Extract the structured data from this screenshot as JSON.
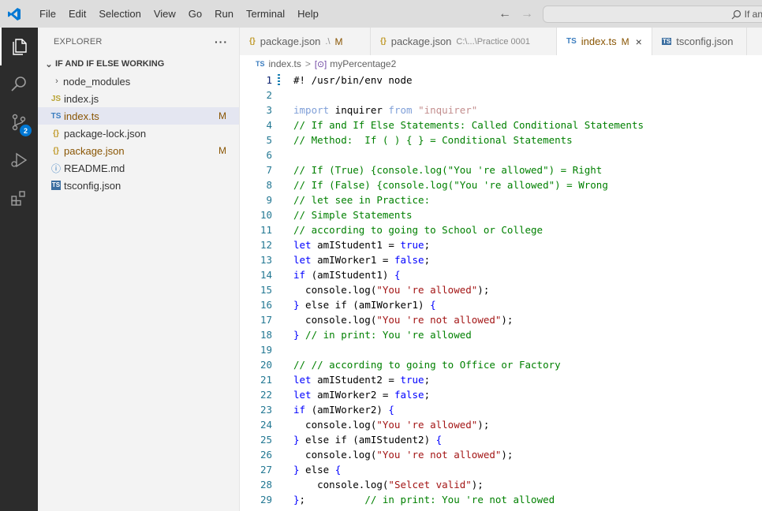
{
  "titlebar": {
    "menu": [
      "File",
      "Edit",
      "Selection",
      "View",
      "Go",
      "Run",
      "Terminal",
      "Help"
    ],
    "search_text": "If an",
    "accent_color": "#007acc"
  },
  "activitybar": {
    "items": [
      "explorer-icon",
      "search-icon",
      "source-control-icon",
      "run-debug-icon",
      "extensions-icon"
    ],
    "source_control_badge": "2"
  },
  "sidebar": {
    "title": "EXPLORER",
    "more": "···",
    "folder": "IF AND IF ELSE WORKING",
    "items": [
      {
        "name": "node_modules",
        "type": "folder",
        "icon": ""
      },
      {
        "name": "index.js",
        "type": "js",
        "icon": "JS"
      },
      {
        "name": "index.ts",
        "type": "ts",
        "icon": "TS",
        "status": "M"
      },
      {
        "name": "package-lock.json",
        "type": "json",
        "icon": "{}"
      },
      {
        "name": "package.json",
        "type": "json",
        "icon": "{}",
        "status": "M"
      },
      {
        "name": "README.md",
        "type": "info",
        "icon": "ⓘ"
      },
      {
        "name": "tsconfig.json",
        "type": "tsconfig",
        "icon": "TS"
      }
    ]
  },
  "tabs": [
    {
      "label": "package.json",
      "icon": "{}",
      "desc": ".\\",
      "status": "M"
    },
    {
      "label": "package.json",
      "icon": "{}",
      "desc": "C:\\...\\Practice 0001",
      "status": ""
    },
    {
      "label": "index.ts",
      "icon": "TS",
      "desc": "",
      "status": "M",
      "close": "×"
    },
    {
      "label": "tsconfig.json",
      "icon": "TS",
      "desc": "",
      "status": ""
    }
  ],
  "breadcrumbs": {
    "file_icon": "TS",
    "file": "index.ts",
    "separator": ">",
    "symbol_icon": "[⊙]",
    "symbol": "myPercentage2"
  },
  "editor": {
    "lines": [
      {
        "n": "1",
        "tokens": [
          {
            "t": "#! /usr/bin/env node",
            "c": "plain"
          }
        ]
      },
      {
        "n": "2",
        "tokens": []
      },
      {
        "n": "3",
        "tokens": [
          {
            "t": "import",
            "c": "kwdim"
          },
          {
            "t": " inquirer ",
            "c": "plain"
          },
          {
            "t": "from",
            "c": "kwdim"
          },
          {
            "t": " ",
            "c": "plain"
          },
          {
            "t": "\"inquirer\"",
            "c": "strdim"
          }
        ]
      },
      {
        "n": "4",
        "tokens": [
          {
            "t": "// If and If Else Statements: Called Conditional Statements",
            "c": "comment"
          }
        ]
      },
      {
        "n": "5",
        "tokens": [
          {
            "t": "// Method:  If ( ) { } = Conditional Statements",
            "c": "comment"
          }
        ]
      },
      {
        "n": "6",
        "tokens": []
      },
      {
        "n": "7",
        "tokens": [
          {
            "t": "// If (True) {console.log(\"You 're allowed\") = Right",
            "c": "comment"
          }
        ]
      },
      {
        "n": "8",
        "tokens": [
          {
            "t": "// If (False) {console.log(\"You 're allowed\") = Wrong",
            "c": "comment"
          }
        ]
      },
      {
        "n": "9",
        "tokens": [
          {
            "t": "// let see in Practice:",
            "c": "comment"
          }
        ]
      },
      {
        "n": "10",
        "tokens": [
          {
            "t": "// Simple Statements",
            "c": "comment"
          }
        ]
      },
      {
        "n": "11",
        "tokens": [
          {
            "t": "// according to going to School or College",
            "c": "comment"
          }
        ]
      },
      {
        "n": "12",
        "tokens": [
          {
            "t": "let",
            "c": "kw"
          },
          {
            "t": " amIStudent1 = ",
            "c": "plain"
          },
          {
            "t": "true",
            "c": "kw"
          },
          {
            "t": ";",
            "c": "plain"
          }
        ]
      },
      {
        "n": "13",
        "tokens": [
          {
            "t": "let",
            "c": "kw"
          },
          {
            "t": " amIWorker1 = ",
            "c": "plain"
          },
          {
            "t": "false",
            "c": "kw"
          },
          {
            "t": ";",
            "c": "plain"
          }
        ]
      },
      {
        "n": "14",
        "tokens": [
          {
            "t": "if",
            "c": "kw"
          },
          {
            "t": " (amIStudent1) ",
            "c": "plain"
          },
          {
            "t": "{",
            "c": "kw"
          }
        ]
      },
      {
        "n": "15",
        "tokens": [
          {
            "t": "  console.log(",
            "c": "plain"
          },
          {
            "t": "\"You 're allowed\"",
            "c": "str"
          },
          {
            "t": ");",
            "c": "plain"
          }
        ]
      },
      {
        "n": "16",
        "tokens": [
          {
            "t": "}",
            "c": "kw"
          },
          {
            "t": " else if ",
            "c": "plain"
          },
          {
            "t": "(amIWorker1) ",
            "c": "plain"
          },
          {
            "t": "{",
            "c": "kw"
          }
        ]
      },
      {
        "n": "17",
        "tokens": [
          {
            "t": "  console.log(",
            "c": "plain"
          },
          {
            "t": "\"You 're not allowed\"",
            "c": "str"
          },
          {
            "t": ");",
            "c": "plain"
          }
        ]
      },
      {
        "n": "18",
        "tokens": [
          {
            "t": "}",
            "c": "kw"
          },
          {
            "t": " // in print: You 're allowed",
            "c": "comment"
          }
        ]
      },
      {
        "n": "19",
        "tokens": []
      },
      {
        "n": "20",
        "tokens": [
          {
            "t": "// // according to going to Office or Factory",
            "c": "comment"
          }
        ]
      },
      {
        "n": "21",
        "tokens": [
          {
            "t": "let",
            "c": "kw"
          },
          {
            "t": " amIStudent2 = ",
            "c": "plain"
          },
          {
            "t": "true",
            "c": "kw"
          },
          {
            "t": ";",
            "c": "plain"
          }
        ]
      },
      {
        "n": "22",
        "tokens": [
          {
            "t": "let",
            "c": "kw"
          },
          {
            "t": " amIWorker2 = ",
            "c": "plain"
          },
          {
            "t": "false",
            "c": "kw"
          },
          {
            "t": ";",
            "c": "plain"
          }
        ]
      },
      {
        "n": "23",
        "tokens": [
          {
            "t": "if",
            "c": "kw"
          },
          {
            "t": " (amIWorker2) ",
            "c": "plain"
          },
          {
            "t": "{",
            "c": "kw"
          }
        ]
      },
      {
        "n": "24",
        "tokens": [
          {
            "t": "  console.log(",
            "c": "plain"
          },
          {
            "t": "\"You 're allowed\"",
            "c": "str"
          },
          {
            "t": ");",
            "c": "plain"
          }
        ]
      },
      {
        "n": "25",
        "tokens": [
          {
            "t": "}",
            "c": "kw"
          },
          {
            "t": " else if ",
            "c": "plain"
          },
          {
            "t": "(amIStudent2) ",
            "c": "plain"
          },
          {
            "t": "{",
            "c": "kw"
          }
        ]
      },
      {
        "n": "26",
        "tokens": [
          {
            "t": "  console.log(",
            "c": "plain"
          },
          {
            "t": "\"You 're not allowed\"",
            "c": "str"
          },
          {
            "t": ");",
            "c": "plain"
          }
        ]
      },
      {
        "n": "27",
        "tokens": [
          {
            "t": "}",
            "c": "kw"
          },
          {
            "t": " else ",
            "c": "plain"
          },
          {
            "t": "{",
            "c": "kw"
          }
        ]
      },
      {
        "n": "28",
        "tokens": [
          {
            "t": "    console.log(",
            "c": "plain"
          },
          {
            "t": "\"Selcet valid\"",
            "c": "str"
          },
          {
            "t": ");",
            "c": "plain"
          }
        ]
      },
      {
        "n": "29",
        "tokens": [
          {
            "t": "}",
            "c": "kw"
          },
          {
            "t": ";          ",
            "c": "plain"
          },
          {
            "t": "// in print: You 're not allowed",
            "c": "comment"
          }
        ]
      }
    ]
  }
}
